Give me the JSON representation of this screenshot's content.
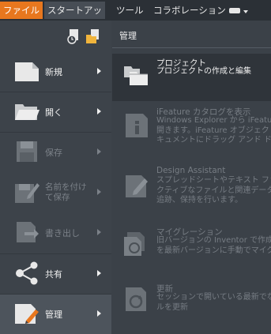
{
  "ribbon": {
    "tabs": [
      "ファイル",
      "スタートアップ",
      "ツール",
      "コラボレーション"
    ],
    "view_selector_icon": "window-icon"
  },
  "menu": {
    "items": [
      {
        "label": "新規",
        "icon": "new-document-icon",
        "enabled": true,
        "has_submenu": true
      },
      {
        "label": "開く",
        "icon": "open-folder-icon",
        "enabled": true,
        "has_submenu": true
      },
      {
        "label": "保存",
        "icon": "save-disk-icon",
        "enabled": false,
        "has_submenu": true
      },
      {
        "label": "名前を付けて保存",
        "icon": "save-as-icon",
        "enabled": false,
        "has_submenu": true
      },
      {
        "label": "書き出し",
        "icon": "export-icon",
        "enabled": false,
        "has_submenu": true
      },
      {
        "label": "共有",
        "icon": "share-icon",
        "enabled": true,
        "has_submenu": true
      },
      {
        "label": "管理",
        "icon": "manage-icon",
        "enabled": true,
        "has_submenu": true,
        "selected": true
      }
    ]
  },
  "panel": {
    "title": "管理",
    "entries": [
      {
        "title": "プロジェクト",
        "desc": [
          "プロジェクトの作成と編集"
        ],
        "icon": "project-folder-icon",
        "enabled": true
      },
      {
        "title": "iFeature カタログを表示",
        "desc": [
          "Windows Explorer から iFeature",
          "開きます。iFeature オブジェクトは",
          "キュメントにドラッグ アンド ドロップ"
        ],
        "icon": "ifeature-catalog-icon",
        "enabled": false
      },
      {
        "title": "Design Assistant",
        "desc": [
          "スプレッドシートやテキスト ファイルを",
          "クティブなファイルと関連データ ファ",
          "追跡、保持を行います。"
        ],
        "icon": "design-assistant-icon",
        "enabled": false
      },
      {
        "title": "マイグレーション",
        "desc": [
          "旧バージョンの Inventor で作成さ",
          "を最新バージョンに手動でマイグレ"
        ],
        "icon": "migration-icon",
        "enabled": false
      },
      {
        "title": "更新",
        "desc": [
          "セッションで開いている最新でない",
          "ルを更新"
        ],
        "icon": "update-icon",
        "enabled": false
      }
    ]
  },
  "colors": {
    "file_tab": "#e8771e",
    "background": "#3b4148"
  }
}
